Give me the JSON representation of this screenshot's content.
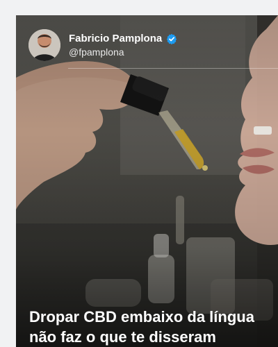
{
  "post": {
    "author_name": "Fabricio Pamplona",
    "author_handle": "@fpamplona",
    "verified": true,
    "headline_line1": "Dropar CBD embaixo da língua",
    "headline_line2": "não faz o que te disseram"
  },
  "icons": {
    "avatar": "author-avatar",
    "verified": "verified-badge-icon"
  },
  "colors": {
    "verified_blue": "#1d9bf0",
    "oil": "#c9a227"
  }
}
